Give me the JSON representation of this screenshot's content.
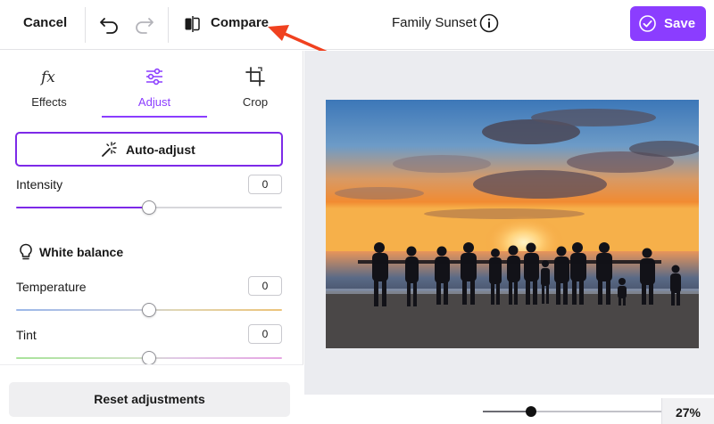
{
  "header": {
    "cancel_label": "Cancel",
    "compare_label": "Compare",
    "title": "Family Sunset",
    "save_label": "Save"
  },
  "tabs": [
    {
      "label": "Effects",
      "icon": "fx-icon",
      "active": false
    },
    {
      "label": "Adjust",
      "icon": "sliders-icon",
      "active": true
    },
    {
      "label": "Crop",
      "icon": "crop-icon",
      "active": false
    }
  ],
  "auto_adjust_label": "Auto-adjust",
  "intensity": {
    "label": "Intensity",
    "value": "0",
    "level": 0.5
  },
  "white_balance": {
    "heading": "White balance",
    "temperature": {
      "label": "Temperature",
      "value": "0",
      "level": 0.5
    },
    "tint": {
      "label": "Tint",
      "value": "0",
      "level": 0.5
    }
  },
  "reset_label": "Reset adjustments",
  "zoom": {
    "label": "27%",
    "level": 0.27
  },
  "colors": {
    "accent": "#8b3dff",
    "accent_dark": "#7d2ae8",
    "annotation_arrow": "#f0411f",
    "canvas_bg": "#ebecf0"
  }
}
